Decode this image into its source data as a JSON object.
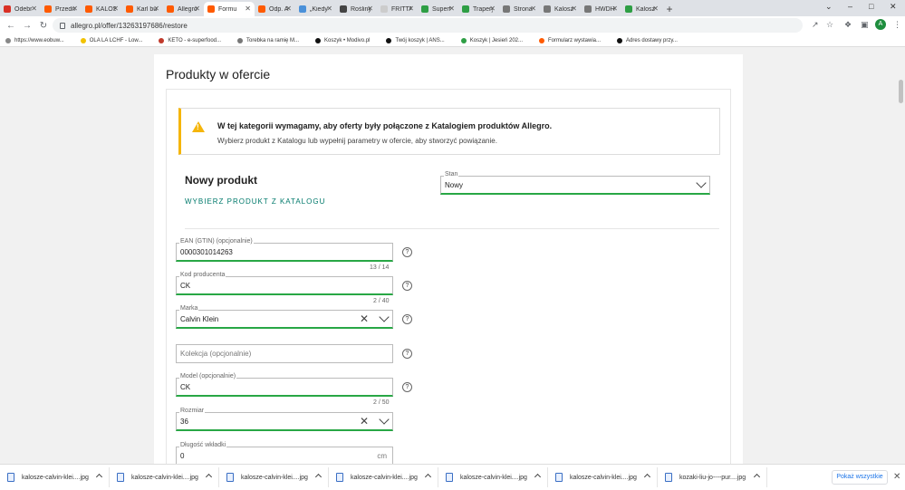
{
  "tabs": [
    {
      "label": "Odebr",
      "color": "#d93025"
    },
    {
      "label": "Przedm",
      "color": "#ff5a00"
    },
    {
      "label": "KALOS",
      "color": "#ff5a00"
    },
    {
      "label": "Karl bu",
      "color": "#ff5a00"
    },
    {
      "label": "Allegro",
      "color": "#ff5a00"
    },
    {
      "label": "Formu",
      "color": "#ff5a00",
      "active": true
    },
    {
      "label": "Odp. A",
      "color": "#ff5a00"
    },
    {
      "label": "„Kiedy",
      "color": "#4a90d9"
    },
    {
      "label": "Rośliny",
      "color": "#444444"
    },
    {
      "label": "FRITTA",
      "color": "#cccccc"
    },
    {
      "label": "Superf",
      "color": "#2e9e44"
    },
    {
      "label": "Trapery",
      "color": "#2e9e44"
    },
    {
      "label": "Strona",
      "color": "#777777"
    },
    {
      "label": "Kalosz",
      "color": "#777777"
    },
    {
      "label": "HWDH",
      "color": "#777777"
    },
    {
      "label": "Kalosz",
      "color": "#2e9e44"
    }
  ],
  "address": {
    "url": "allegro.pl/offer/13263197686/restore"
  },
  "bookmarks": [
    {
      "label": "https://www.eobuw...",
      "color": "#888888"
    },
    {
      "label": "OLA LA LCHF - Low...",
      "color": "#f2c200"
    },
    {
      "label": "KETO - e-superfood...",
      "color": "#c0392b"
    },
    {
      "label": "Torebka na ramię M...",
      "color": "#777777"
    },
    {
      "label": "Koszyk • Modivo.pl",
      "color": "#111111"
    },
    {
      "label": "Twój koszyk | ANS...",
      "color": "#111111"
    },
    {
      "label": "Koszyk | Jesień 202...",
      "color": "#2e9e44"
    },
    {
      "label": "Formularz wystawia...",
      "color": "#ff5a00"
    },
    {
      "label": "Adres dostawy przy...",
      "color": "#111111"
    }
  ],
  "page": {
    "title": "Produkty w ofercie",
    "alert": {
      "title": "W tej kategorii wymagamy, aby oferty były połączone z Katalogiem produktów Allegro.",
      "text": "Wybierz produkt z Katalogu lub wypełnij parametry w ofercie, aby stworzyć powiązanie."
    },
    "section_title": "Nowy produkt",
    "catalog_link": "WYBIERZ PRODUKT Z KATALOGU",
    "stan": {
      "label": "Stan",
      "value": "Nowy"
    },
    "fields": {
      "ean": {
        "label": "EAN (GTIN) (opcjonalnie)",
        "value": "0000301014263",
        "counter": "13  /  14"
      },
      "kod": {
        "label": "Kod producenta",
        "value": "CK",
        "counter": "2  /  40"
      },
      "marka": {
        "label": "Marka",
        "value": "Calvin Klein"
      },
      "kolekcja": {
        "placeholder": "Kolekcja (opcjonalnie)"
      },
      "model": {
        "label": "Model (opcjonalnie)",
        "value": "CK",
        "counter": "2  /  50"
      },
      "rozmiar": {
        "label": "Rozmiar",
        "value": "36"
      },
      "dlugosc": {
        "label": "Długość wkładki",
        "value": "0",
        "suffix": "cm"
      }
    },
    "help_glyph": "?"
  },
  "downloads": [
    {
      "label": "kalosze-calvin-klei....jpg"
    },
    {
      "label": "kalosze-calvin-klei....jpg"
    },
    {
      "label": "kalosze-calvin-klei....jpg"
    },
    {
      "label": "kalosze-calvin-klei....jpg"
    },
    {
      "label": "kalosze-calvin-klei....jpg"
    },
    {
      "label": "kalosze-calvin-klei....jpg"
    },
    {
      "label": "kozaki-liu-jo----pur....jpg"
    }
  ],
  "show_all": "Pokaż wszystkie",
  "avatar_letter": "A"
}
